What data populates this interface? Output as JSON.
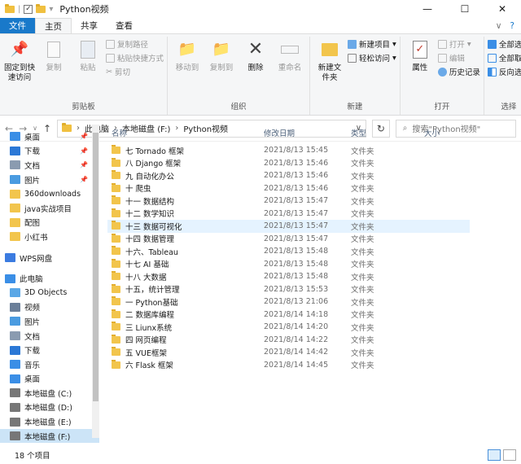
{
  "window": {
    "title": "Python视频",
    "controls": [
      "—",
      "☐",
      "✕"
    ]
  },
  "tabs": [
    "文件",
    "主页",
    "共享",
    "查看"
  ],
  "ribbon": {
    "clipboard": {
      "pin": "固定到快速访问",
      "copy": "复制",
      "paste": "粘贴",
      "copy_path": "复制路径",
      "paste_shortcut": "粘贴快捷方式",
      "cut": "剪切",
      "label": "剪贴板"
    },
    "organize": {
      "move_to": "移动到",
      "copy_to": "复制到",
      "delete": "删除",
      "rename": "重命名",
      "label": "组织"
    },
    "new": {
      "new_folder": "新建文件夹",
      "new_item": "新建项目",
      "easy_access": "轻松访问",
      "label": "新建"
    },
    "open": {
      "properties": "属性",
      "open": "打开",
      "edit": "编辑",
      "history": "历史记录",
      "label": "打开"
    },
    "select": {
      "select_all": "全部选择",
      "select_none": "全部取消",
      "invert": "反向选择",
      "label": "选择"
    }
  },
  "address": {
    "path": [
      "此电脑",
      "本地磁盘 (F:)",
      "Python视频"
    ],
    "search_placeholder": "搜索\"Python视频\""
  },
  "nav": [
    {
      "label": "桌面",
      "pinned": true,
      "color": "#3a8ee6",
      "level": 2
    },
    {
      "label": "下载",
      "pinned": true,
      "color": "#2b78d6",
      "level": 2
    },
    {
      "label": "文档",
      "pinned": true,
      "color": "#8a9bb0",
      "level": 2
    },
    {
      "label": "图片",
      "pinned": true,
      "color": "#4a9be0",
      "level": 2
    },
    {
      "label": "360downloads",
      "pinned": false,
      "color": "#f2c54c",
      "level": 2
    },
    {
      "label": "java实战项目",
      "pinned": false,
      "color": "#f2c54c",
      "level": 2
    },
    {
      "label": "配图",
      "pinned": false,
      "color": "#f2c54c",
      "level": 2
    },
    {
      "label": "小红书",
      "pinned": false,
      "color": "#f2c54c",
      "level": 2
    },
    {
      "label": "WPS网盘",
      "pinned": false,
      "color": "#3b7be0",
      "level": 1
    },
    {
      "label": "此电脑",
      "pinned": false,
      "color": "#3a8ee6",
      "level": 1
    },
    {
      "label": "3D Objects",
      "pinned": false,
      "color": "#5aa7e6",
      "level": 2
    },
    {
      "label": "视频",
      "pinned": false,
      "color": "#6b7f99",
      "level": 2
    },
    {
      "label": "图片",
      "pinned": false,
      "color": "#4a9be0",
      "level": 2
    },
    {
      "label": "文档",
      "pinned": false,
      "color": "#8a9bb0",
      "level": 2
    },
    {
      "label": "下载",
      "pinned": false,
      "color": "#2b78d6",
      "level": 2
    },
    {
      "label": "音乐",
      "pinned": false,
      "color": "#3a8ee6",
      "level": 2
    },
    {
      "label": "桌面",
      "pinned": false,
      "color": "#3a8ee6",
      "level": 2
    },
    {
      "label": "本地磁盘 (C:)",
      "pinned": false,
      "color": "#777777",
      "level": 2
    },
    {
      "label": "本地磁盘 (D:)",
      "pinned": false,
      "color": "#777777",
      "level": 2
    },
    {
      "label": "本地磁盘 (E:)",
      "pinned": false,
      "color": "#777777",
      "level": 2
    },
    {
      "label": "本地磁盘 (F:)",
      "pinned": false,
      "color": "#777777",
      "level": 2,
      "selected": true
    }
  ],
  "columns": {
    "name": "名称",
    "date": "修改日期",
    "type": "类型",
    "size": "大小"
  },
  "files": [
    {
      "name": "七 Tornado 框架",
      "date": "2021/8/13 15:45",
      "type": "文件夹"
    },
    {
      "name": "八 Django 框架",
      "date": "2021/8/13 15:46",
      "type": "文件夹"
    },
    {
      "name": "九 自动化办公",
      "date": "2021/8/13 15:46",
      "type": "文件夹"
    },
    {
      "name": "十 爬虫",
      "date": "2021/8/13 15:46",
      "type": "文件夹"
    },
    {
      "name": "十一  数据结构",
      "date": "2021/8/13 15:47",
      "type": "文件夹"
    },
    {
      "name": "十二  数学知识",
      "date": "2021/8/13 15:47",
      "type": "文件夹"
    },
    {
      "name": "十三  数据可视化",
      "date": "2021/8/13 15:47",
      "type": "文件夹",
      "highlight": true
    },
    {
      "name": "十四 数据管理",
      "date": "2021/8/13 15:47",
      "type": "文件夹"
    },
    {
      "name": "十六、Tableau",
      "date": "2021/8/13 15:48",
      "type": "文件夹"
    },
    {
      "name": "十七  AI 基础",
      "date": "2021/8/13 15:48",
      "type": "文件夹"
    },
    {
      "name": "十八  大数据",
      "date": "2021/8/13 15:48",
      "type": "文件夹"
    },
    {
      "name": "十五，统计管理",
      "date": "2021/8/13 15:53",
      "type": "文件夹"
    },
    {
      "name": "一 Python基础",
      "date": "2021/8/13 21:06",
      "type": "文件夹"
    },
    {
      "name": "二 数据库编程",
      "date": "2021/8/14 14:18",
      "type": "文件夹"
    },
    {
      "name": "三 Liunx系统",
      "date": "2021/8/14 14:20",
      "type": "文件夹"
    },
    {
      "name": "四 网页编程",
      "date": "2021/8/14 14:22",
      "type": "文件夹"
    },
    {
      "name": "五 VUE框架",
      "date": "2021/8/14 14:42",
      "type": "文件夹"
    },
    {
      "name": "六 Flask 框架",
      "date": "2021/8/14 14:45",
      "type": "文件夹"
    }
  ],
  "status": {
    "count": "18 个项目"
  },
  "colors": {
    "accent": "#1979ca",
    "hover": "#e5f3ff",
    "selected": "#cce4f7",
    "folder": "#f2c54c"
  }
}
